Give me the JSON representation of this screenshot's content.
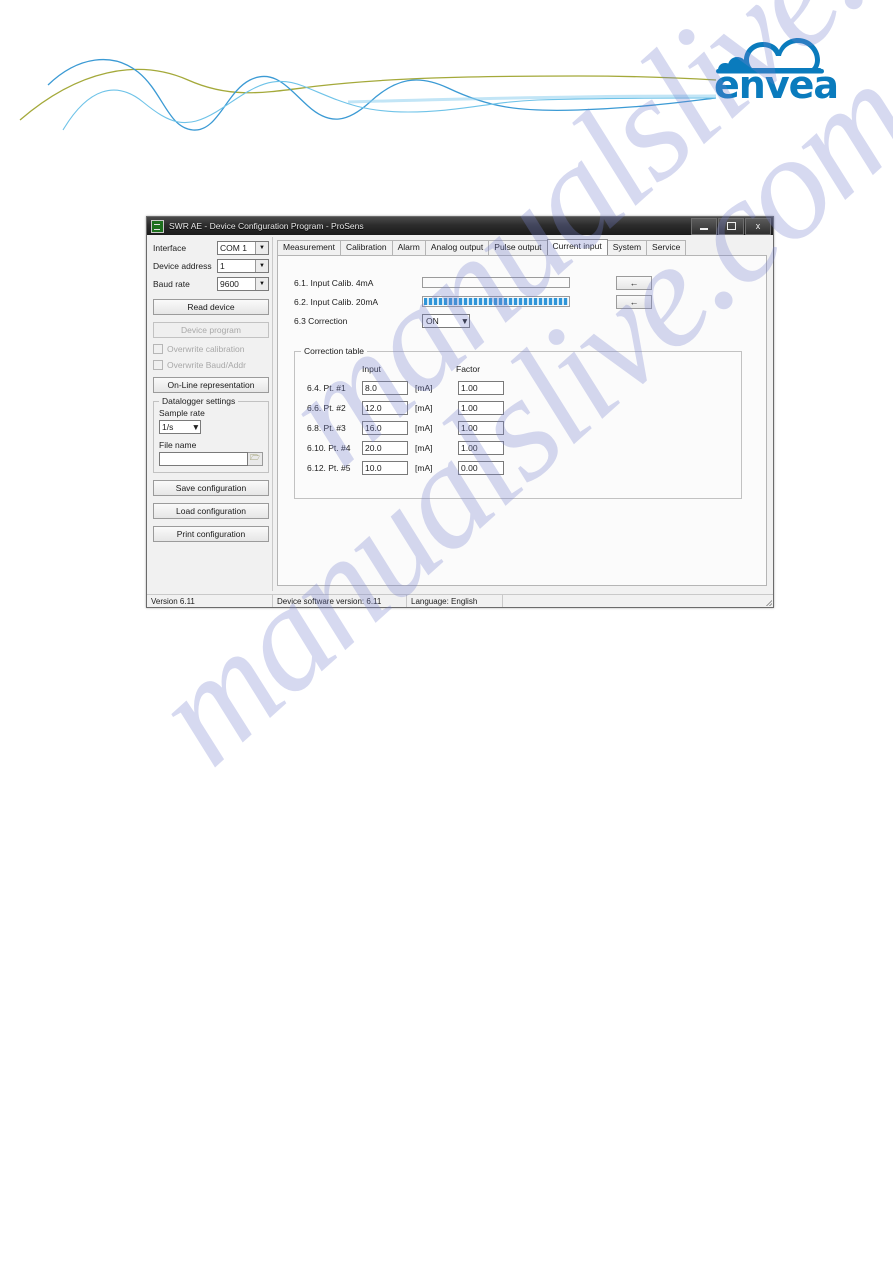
{
  "header": {
    "logo_text": "envea",
    "logo_color": "#0a7bbd",
    "wave_colors": {
      "blue": "#3b9ad4",
      "olive": "#a4a93a",
      "light_blue": "#8fd0ef"
    }
  },
  "watermark": {
    "line1": "manualslive.com",
    "line2": "manualslive.com"
  },
  "window": {
    "title": "SWR AE - Device Configuration Program - ProSens",
    "icon": "app-icon",
    "controls": {
      "minimize": "minimize-icon",
      "maximize": "maximize-icon",
      "close": "x"
    }
  },
  "left_panel": {
    "connection": [
      {
        "label": "Interface",
        "value": "COM 1"
      },
      {
        "label": "Device address",
        "value": "1"
      },
      {
        "label": "Baud rate",
        "value": "9600"
      }
    ],
    "buttons": {
      "read_device": "Read device",
      "device_program": "Device program",
      "online_representation": "On-Line representation",
      "save_configuration": "Save configuration",
      "load_configuration": "Load configuration",
      "print_configuration": "Print configuration"
    },
    "checkboxes": [
      {
        "label": "Overwrite calibration",
        "checked": false,
        "enabled": false
      },
      {
        "label": "Overwrite Baud/Addr",
        "checked": false,
        "enabled": false
      }
    ],
    "datalogger": {
      "title": "Datalogger settings",
      "sample_rate_label": "Sample rate",
      "sample_rate_value": "1/s",
      "file_name_label": "File name",
      "file_name_value": "",
      "folder_icon": "folder-icon"
    }
  },
  "tabs": [
    {
      "label": "Measurement",
      "active": false
    },
    {
      "label": "Calibration",
      "active": false
    },
    {
      "label": "Alarm",
      "active": false
    },
    {
      "label": "Analog output",
      "active": false
    },
    {
      "label": "Pulse output",
      "active": false
    },
    {
      "label": "Current input",
      "active": true
    },
    {
      "label": "System",
      "active": false
    },
    {
      "label": "Service",
      "active": false
    }
  ],
  "current_input": {
    "calibration_rows": [
      {
        "label": "6.1. Input Calib. 4mA",
        "progress": 0,
        "button": "←"
      },
      {
        "label": "6.2. Input Calib. 20mA",
        "progress": 100,
        "button": "←"
      }
    ],
    "correction": {
      "label": "6.3 Correction",
      "value": "ON"
    },
    "correction_table": {
      "title": "Correction table",
      "headers": {
        "input": "Input",
        "factor": "Factor"
      },
      "unit": "[mA]",
      "rows": [
        {
          "label": "6.4. Pt. #1",
          "input": "8.0",
          "factor": "1.00"
        },
        {
          "label": "6.6. Pt. #2",
          "input": "12.0",
          "factor": "1.00"
        },
        {
          "label": "6.8. Pt. #3",
          "input": "16.0",
          "factor": "1.00"
        },
        {
          "label": "6.10. Pt. #4",
          "input": "20.0",
          "factor": "1.00"
        },
        {
          "label": "6.12. Pt. #5",
          "input": "10.0",
          "factor": "0.00"
        }
      ]
    }
  },
  "status_bar": {
    "version": "Version 6.11",
    "device_software_version": "Device software version: 6.11",
    "language": "Language: English",
    "empty": ""
  }
}
